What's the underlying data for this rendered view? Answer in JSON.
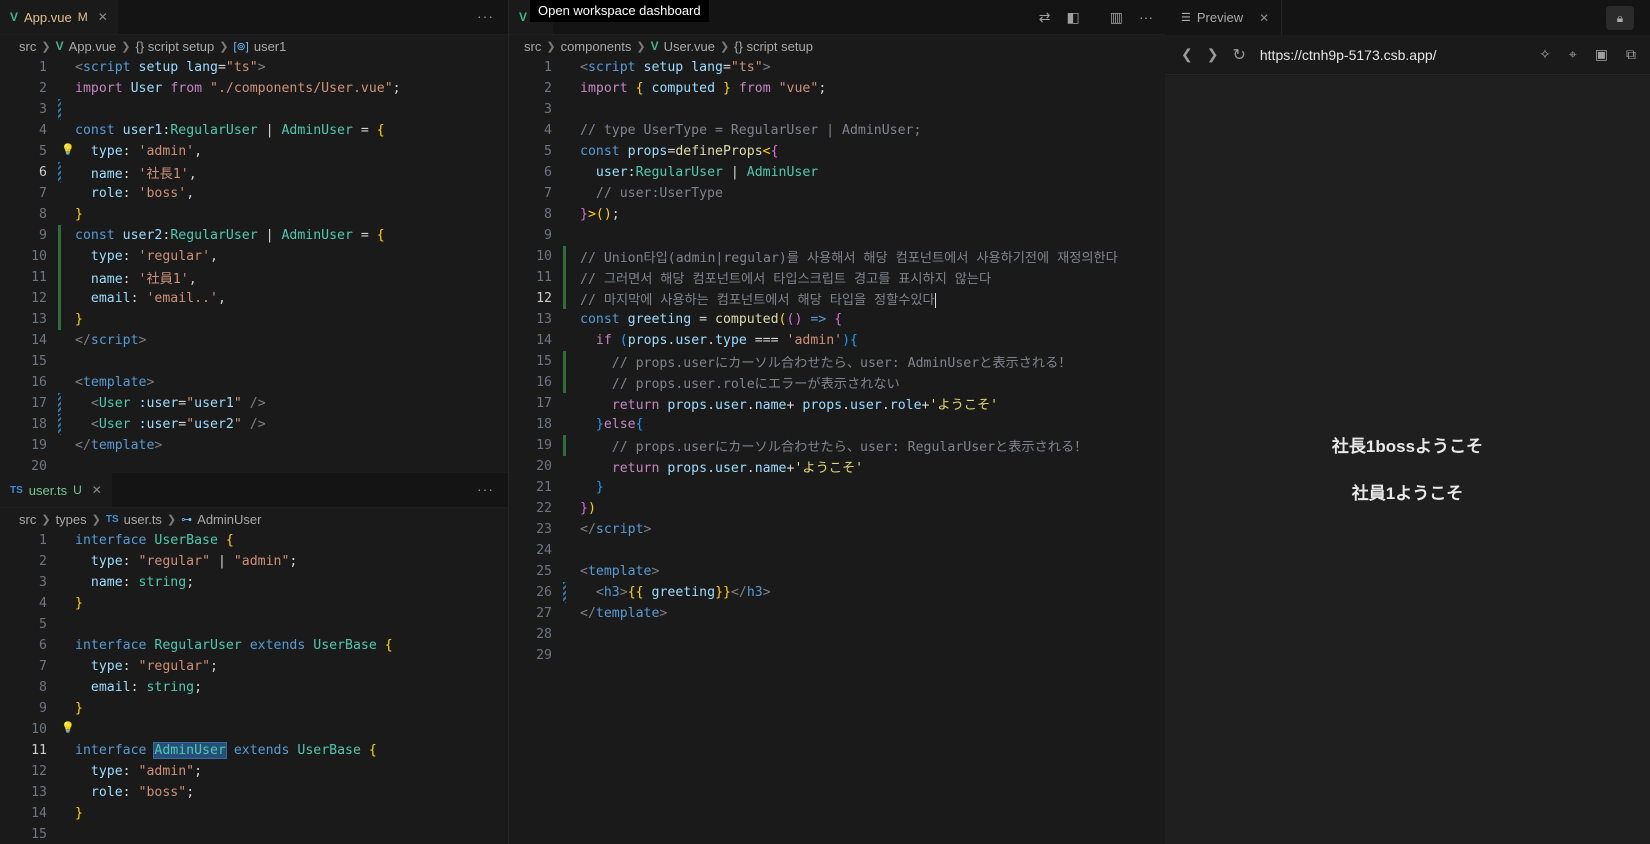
{
  "tooltip": "Open workspace dashboard",
  "left_top": {
    "tab": {
      "icon": "V",
      "label": "App.vue",
      "status": "M"
    },
    "crumbs": [
      "src",
      "App.vue",
      "{} script setup",
      "user1"
    ]
  },
  "left_bottom": {
    "tab": {
      "icon": "TS",
      "label": "user.ts",
      "status": "U"
    },
    "crumbs": [
      "src",
      "types",
      "user.ts",
      "AdminUser"
    ]
  },
  "middle": {
    "tab": {
      "icon": "V",
      "label": "Us"
    },
    "crumbs": [
      "src",
      "components",
      "User.vue",
      "{} script setup"
    ]
  },
  "preview": {
    "tab_label": "Preview",
    "url": "https://ctnh9p-5173.csb.app/",
    "lines": [
      "社長1bossようこそ",
      "社員1ようこそ"
    ]
  },
  "colors": {
    "accent_vue": "#41b883",
    "accent_ts": "#3b8fd6",
    "modified": "#e2c08d",
    "untracked": "#73c991"
  },
  "icons": [
    "vue-file-icon",
    "ts-file-icon",
    "close-icon",
    "more-icon",
    "chevron-right-icon",
    "symbol-icon",
    "lightbulb-icon",
    "compare-icon",
    "split-icon",
    "layout-icon",
    "back-icon",
    "forward-icon",
    "reload-icon",
    "sparkle-icon",
    "target-icon",
    "terminal-icon",
    "open-window-icon",
    "lock-icon",
    "preview-icon"
  ]
}
